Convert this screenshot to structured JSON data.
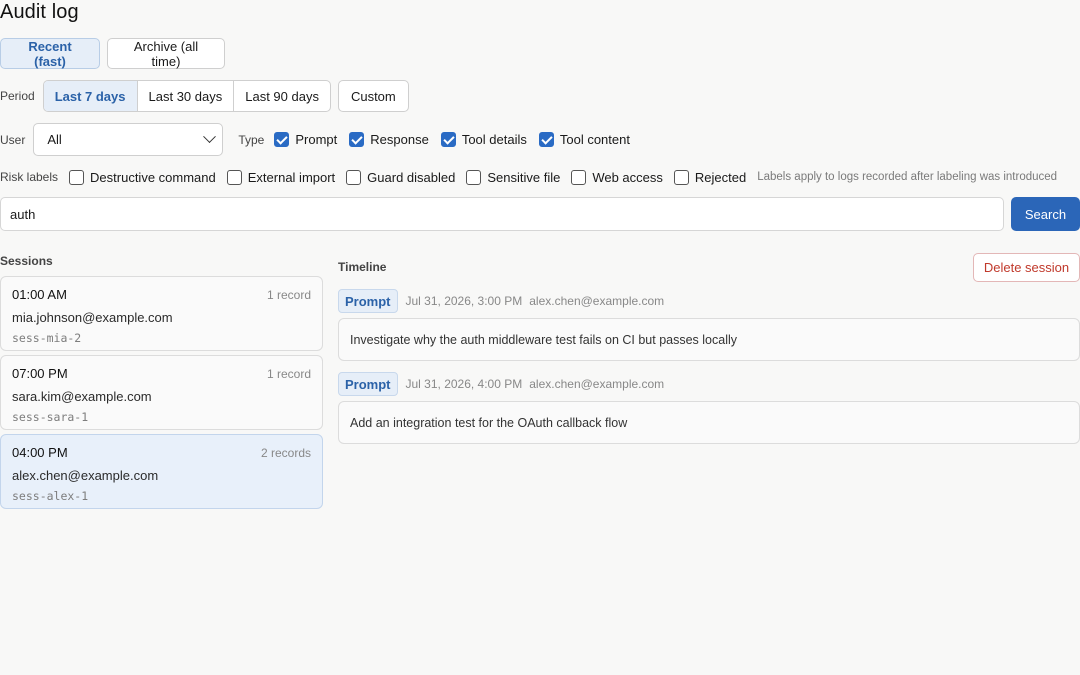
{
  "title": "Audit log",
  "source_tabs": [
    {
      "label": "Recent (fast)",
      "active": true
    },
    {
      "label": "Archive (all time)",
      "active": false
    }
  ],
  "period": {
    "label": "Period",
    "options": [
      {
        "label": "Last 7 days",
        "active": true
      },
      {
        "label": "Last 30 days",
        "active": false
      },
      {
        "label": "Last 90 days",
        "active": false
      }
    ],
    "custom_label": "Custom"
  },
  "user_filter": {
    "label": "User",
    "selected": "All"
  },
  "type_filter": {
    "label": "Type",
    "options": [
      {
        "label": "Prompt",
        "checked": true
      },
      {
        "label": "Response",
        "checked": true
      },
      {
        "label": "Tool details",
        "checked": true
      },
      {
        "label": "Tool content",
        "checked": true
      }
    ]
  },
  "risk_filter": {
    "label": "Risk labels",
    "options": [
      {
        "label": "Destructive command",
        "checked": false
      },
      {
        "label": "External import",
        "checked": false
      },
      {
        "label": "Guard disabled",
        "checked": false
      },
      {
        "label": "Sensitive file",
        "checked": false
      },
      {
        "label": "Web access",
        "checked": false
      },
      {
        "label": "Rejected",
        "checked": false
      }
    ],
    "hint": "Labels apply to logs recorded after labeling was introduced"
  },
  "search": {
    "value": "auth",
    "button_label": "Search"
  },
  "sessions": {
    "title": "Sessions",
    "items": [
      {
        "time": "01:00 AM",
        "count": "1 record",
        "user": "mia.johnson@example.com",
        "id": "sess-mia-2",
        "selected": false
      },
      {
        "time": "07:00 PM",
        "count": "1 record",
        "user": "sara.kim@example.com",
        "id": "sess-sara-1",
        "selected": false
      },
      {
        "time": "04:00 PM",
        "count": "2 records",
        "user": "alex.chen@example.com",
        "id": "sess-alex-1",
        "selected": true
      }
    ]
  },
  "timeline": {
    "title": "Timeline",
    "delete_label": "Delete session",
    "events": [
      {
        "type": "Prompt",
        "time": "Jul 31, 2026, 3:00 PM",
        "user": "alex.chen@example.com",
        "text": "Investigate why the auth middleware test fails on CI but passes locally"
      },
      {
        "type": "Prompt",
        "time": "Jul 31, 2026, 4:00 PM",
        "user": "alex.chen@example.com",
        "text": "Add an integration test for the OAuth callback flow"
      }
    ]
  },
  "colors": {
    "accent": "#2b66b8",
    "danger": "#c0392b",
    "selected_bg": "#e8f0fa"
  }
}
